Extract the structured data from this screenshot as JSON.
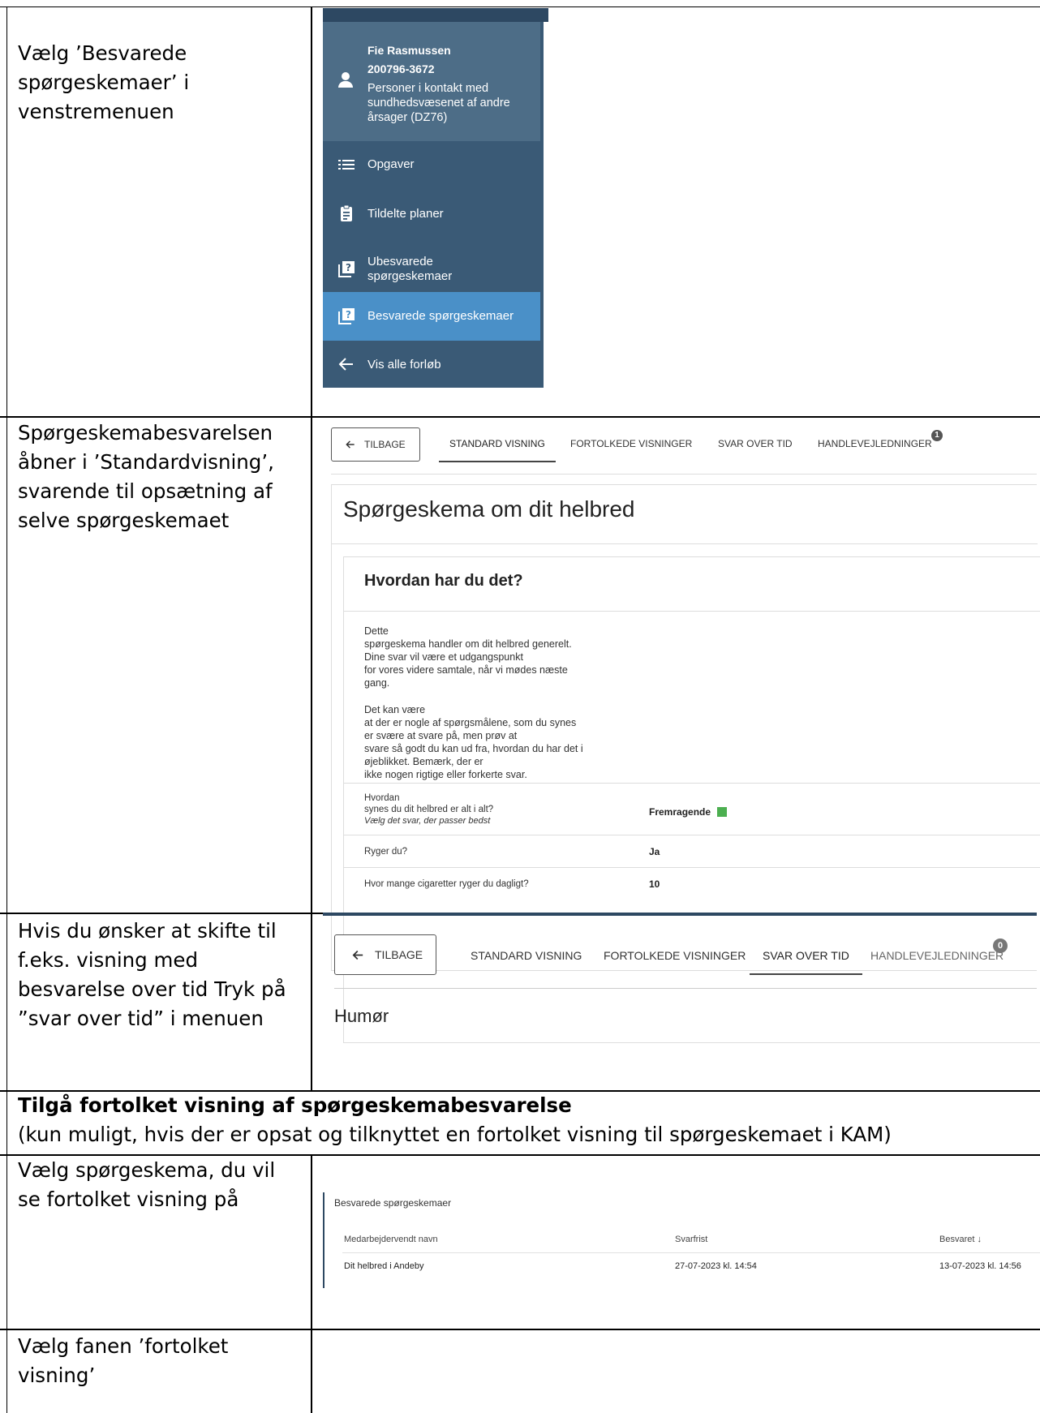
{
  "rows": {
    "r1": {
      "instruction": "Vælg ’Besvarede spørgeskemaer’ i venstremenuen"
    },
    "r2": {
      "instruction": "Spørgeskemabesvarelsen åbner i ’Standardvisning’, svarende til opsætning af selve spørgeskemaet"
    },
    "r3": {
      "instruction": "Hvis du ønsker at skifte til f.eks. visning med besvarelse over tid Tryk på ”svar over tid” i menuen"
    },
    "r4": {
      "title": "Tilgå fortolket visning af spørgeskemabesvarelse",
      "subtitle": "(kun muligt, hvis der er opsat og tilknyttet en fortolket visning til spørgeskemaet i KAM)"
    },
    "r5": {
      "instruction": "Vælg spørgeskema, du vil se fortolket visning på"
    },
    "r6": {
      "instruction": "Vælg fanen ’fortolket visning’"
    }
  },
  "sidebar": {
    "user_name": "Fie Rasmussen",
    "cpr": "200796-3672",
    "diagnosis": "Personer i kontakt med sundhedsvæsenet af andre årsager (DZ76)",
    "items": [
      {
        "label": "Opgaver",
        "icon": "list-icon"
      },
      {
        "label": "Tildelte planer",
        "icon": "clipboard-icon"
      },
      {
        "label": "Ubesvarede spørgeskemaer",
        "icon": "question-doc-icon"
      },
      {
        "label": "Besvarede spørgeskemaer",
        "icon": "question-doc-icon",
        "active": true
      },
      {
        "label": "Vis alle forløb",
        "icon": "arrow-left-icon"
      }
    ]
  },
  "tabs": {
    "back": "TILBAGE",
    "standard": "STANDARD VISNING",
    "fortolkede": "FORTOLKEDE VISNINGER",
    "svar": "SVAR OVER TID",
    "handle": "HANDLEVEJLEDNINGER",
    "badge_r2": "1",
    "badge_r3": "0"
  },
  "form": {
    "title": "Spørgeskema om dit helbred",
    "section_title": "Hvordan har du det?",
    "intro_1": "Dette\nspørgeskema handler om dit helbred generelt.\nDine svar vil være et udgangspunkt\nfor vores videre samtale, når vi mødes næste\ngang.",
    "intro_2": "Det kan være\nat der er nogle af spørgsmålene, som du synes\ner svære at svare på, men prøv at\nsvare så godt du kan ud fra, hvordan du har det i\nøjeblikket. Bemærk, der er\nikke nogen rigtige eller forkerte svar.",
    "q1_label": "Hvordan\nsynes du dit helbred er alt i alt?",
    "q1_hint": "Vælg det svar, der passer bedst",
    "q1_answer": "Fremragende",
    "q2_label": "Ryger du?",
    "q2_answer": "Ja",
    "q3_label": "Hvor mange cigaretter ryger du dagligt?",
    "q3_answer": "10"
  },
  "r3_panel": {
    "heading": "Humør"
  },
  "answered_list": {
    "title": "Besvarede spørgeskemaer",
    "col_name": "Medarbejdervendt navn",
    "col_deadline": "Svarfrist",
    "col_answered": "Besvaret ↓",
    "rows": [
      {
        "name": "Dit helbred i Andeby",
        "deadline": "27-07-2023 kl. 14:54",
        "answered": "13-07-2023 kl. 14:56"
      }
    ]
  },
  "colors": {
    "sidebar": "#3a5a76",
    "sidebar_active": "#4a90c8",
    "accent_green": "#4caf50"
  }
}
